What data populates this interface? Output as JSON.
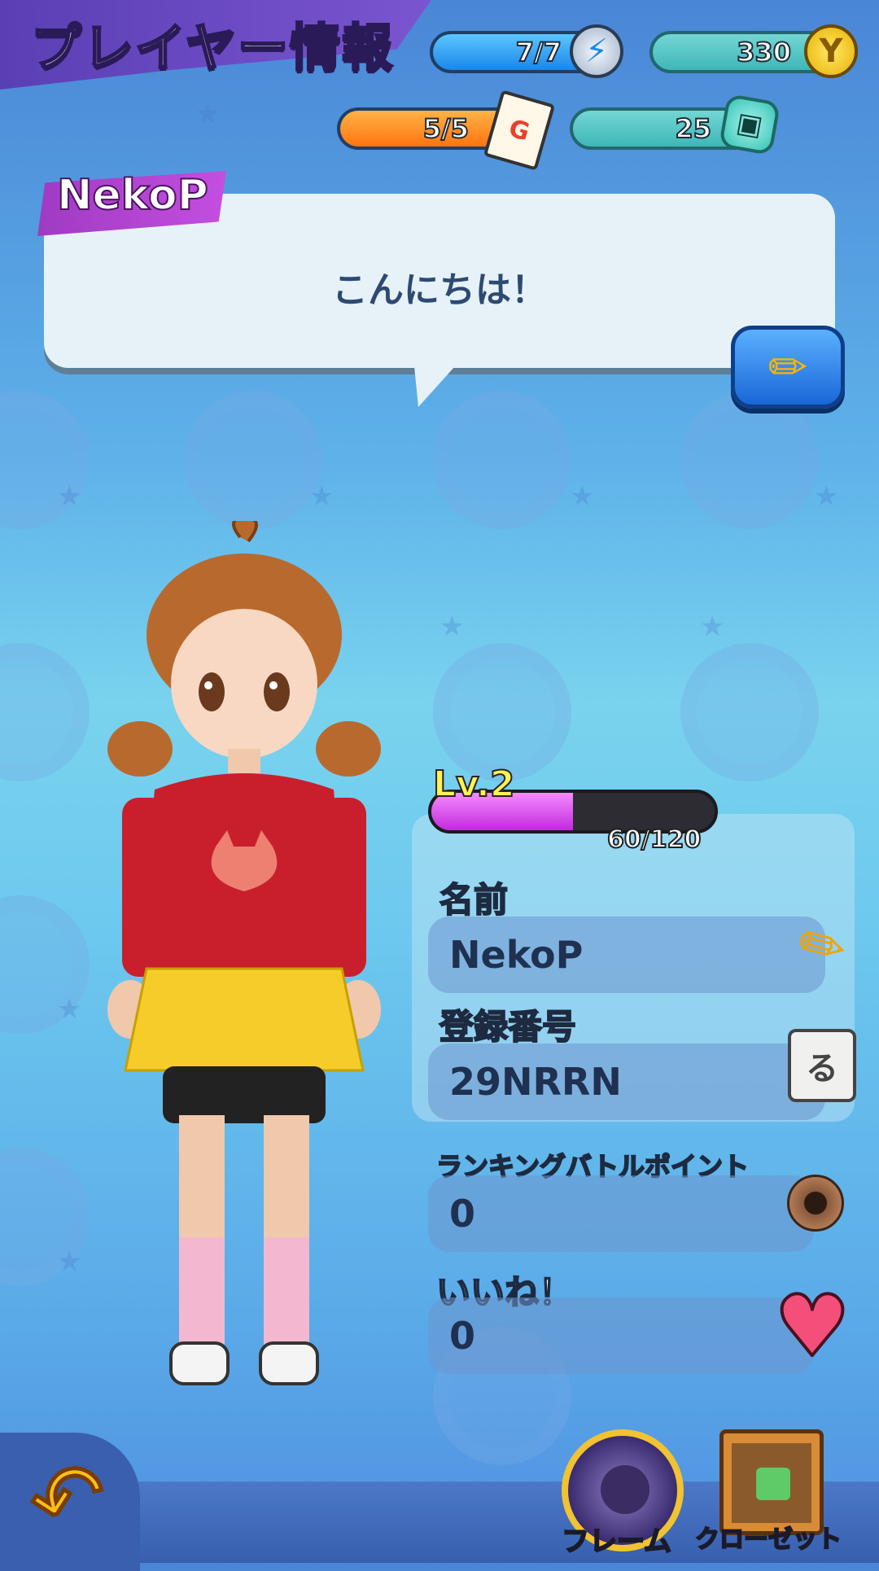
{
  "header": {
    "title": "プレイヤー情報"
  },
  "currency": {
    "stamina": "7/7",
    "ticket": "5/5",
    "money": "330",
    "gems": "25"
  },
  "player": {
    "tag_name": "NekoP",
    "greeting": "こんにちは！",
    "level_label": "Lv.2",
    "exp_text": "60/120",
    "exp_fraction": 0.5
  },
  "fields": {
    "name_label": "名前",
    "name_value": "NekoP",
    "id_label": "登録番号",
    "id_value": "29NRRN",
    "ranking_label": "ランキングバトルポイント",
    "ranking_value": "0",
    "likes_label": "いいね！",
    "likes_value": "0"
  },
  "bottom": {
    "frame_label": "フレーム",
    "closet_label": "クローゼット"
  },
  "icons": {
    "stamina": "lightning-icon",
    "money": "yen-coin-icon",
    "ticket": "ticket-icon",
    "gems": "gem-icon",
    "edit": "pencil-icon",
    "copy": "copy-icon",
    "ranking": "camera-icon",
    "likes": "heart-icon",
    "back": "back-arrow-icon"
  }
}
